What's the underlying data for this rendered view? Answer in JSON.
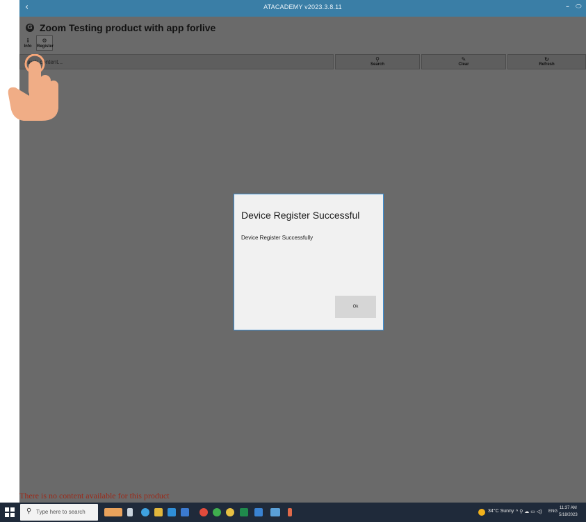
{
  "window": {
    "back_glyph": "‹",
    "title": "ATACADEMY v2023.3.8.11",
    "minimize_glyph": "–",
    "maximize_glyph": "⬭"
  },
  "header": {
    "product_title": "Zoom Testing product with app forlive",
    "icon_glyph": "G"
  },
  "menu": {
    "info_label": "Info",
    "register_label": "Register"
  },
  "search": {
    "placeholder": "earch content..."
  },
  "toolbar": {
    "search_label": "Search",
    "clear_label": "Clear",
    "refresh_label": "Refresh"
  },
  "status": {
    "no_content": "There is no content available for this product"
  },
  "dialog": {
    "title": "Device Register Successful",
    "message": "Device Register Successfully",
    "ok_label": "Ok"
  },
  "taskbar": {
    "search_placeholder": "Type here to search",
    "weather": "34°C Sunny",
    "language": "ENG",
    "time": "11:37 AM",
    "date": "5/18/2023"
  },
  "colors": {
    "titlebar": "#3a7ea6",
    "app_background": "#6a6a6a",
    "dialog_border": "#3b8fd6",
    "error_text": "#9b2a1a",
    "taskbar": "#1f2a3a"
  }
}
